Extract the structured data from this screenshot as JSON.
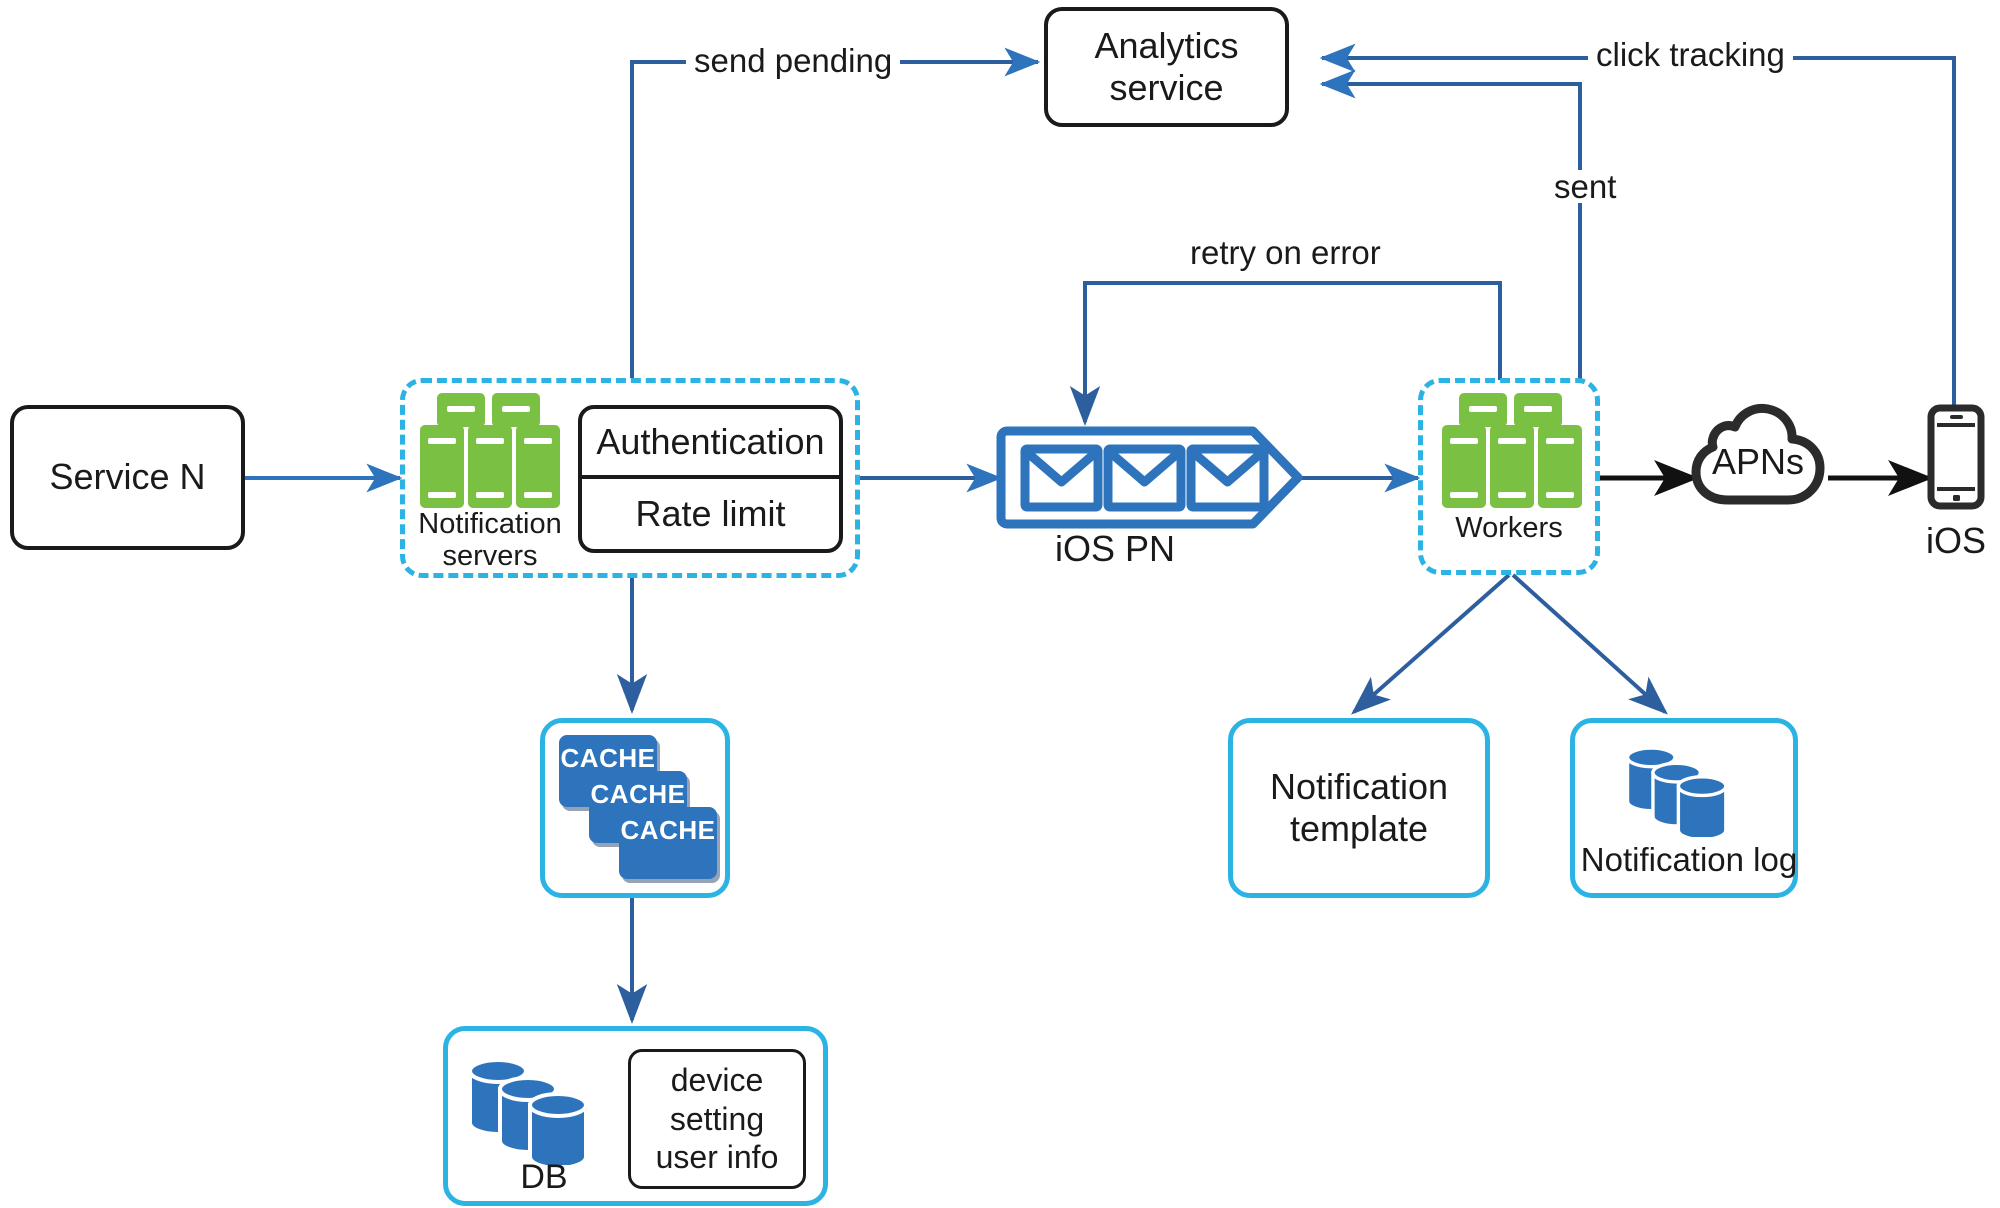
{
  "diagram": {
    "title": "iOS push notification system architecture",
    "colors": {
      "accent_blue": "#2d74bc",
      "cyan": "#2bb3e3",
      "server_green": "#7ac143",
      "black": "#1a1a1a",
      "white": "#ffffff"
    },
    "nodes": {
      "service_n": {
        "label": "Service N"
      },
      "notification_servers": {
        "group_label": "Notification\nservers",
        "auth_label": "Authentication",
        "rate_limit_label": "Rate limit"
      },
      "analytics_service": {
        "label": "Analytics\nservice"
      },
      "ios_pn": {
        "label": "iOS PN"
      },
      "workers": {
        "group_label": "Workers"
      },
      "apns": {
        "label": "APNs"
      },
      "ios_device": {
        "label": "iOS"
      },
      "cache": {
        "cards": [
          "CACHE",
          "CACHE",
          "CACHE"
        ]
      },
      "db": {
        "label": "DB",
        "inner_label": "device\nsetting\nuser info"
      },
      "notification_template": {
        "label": "Notification\ntemplate"
      },
      "notification_log": {
        "label": "Notification log"
      }
    },
    "edges": [
      {
        "id": "send-pending",
        "label": "send pending",
        "from": "notification-servers",
        "to": "analytics-service"
      },
      {
        "id": "click-tracking",
        "label": "click tracking",
        "from": "ios-device",
        "to": "analytics-service"
      },
      {
        "id": "sent",
        "label": "sent",
        "from": "workers",
        "to": "analytics-service"
      },
      {
        "id": "retry-on-error",
        "label": "retry on error",
        "from": "workers",
        "to": "ios-pn"
      },
      {
        "id": "service-to-servers",
        "label": "",
        "from": "service-n",
        "to": "notification-servers"
      },
      {
        "id": "servers-to-queue",
        "label": "",
        "from": "notification-servers",
        "to": "ios-pn"
      },
      {
        "id": "queue-to-workers",
        "label": "",
        "from": "ios-pn",
        "to": "workers"
      },
      {
        "id": "workers-to-apns",
        "label": "",
        "from": "workers",
        "to": "apns"
      },
      {
        "id": "apns-to-ios",
        "label": "",
        "from": "apns",
        "to": "ios-device"
      },
      {
        "id": "servers-to-cache",
        "label": "",
        "from": "notification-servers",
        "to": "cache"
      },
      {
        "id": "cache-to-db",
        "label": "",
        "from": "cache",
        "to": "db"
      },
      {
        "id": "workers-to-template",
        "label": "",
        "from": "workers",
        "to": "notification-template"
      },
      {
        "id": "workers-to-log",
        "label": "",
        "from": "workers",
        "to": "notification-log"
      }
    ]
  }
}
